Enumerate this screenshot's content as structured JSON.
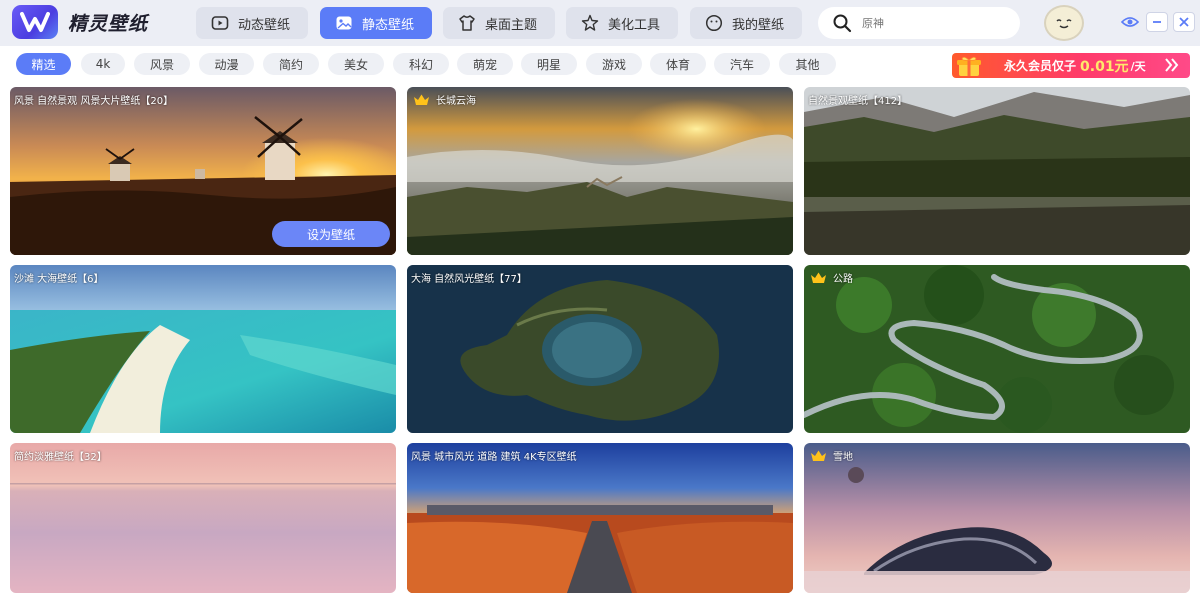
{
  "app": {
    "title": "精灵壁纸"
  },
  "nav": {
    "tabs": [
      {
        "label": "动态壁纸",
        "icon": "play-icon"
      },
      {
        "label": "静态壁纸",
        "icon": "image-icon"
      },
      {
        "label": "桌面主题",
        "icon": "shirt-icon"
      },
      {
        "label": "美化工具",
        "icon": "star-icon"
      },
      {
        "label": "我的壁纸",
        "icon": "smile-icon"
      }
    ],
    "active": "静态壁纸"
  },
  "search": {
    "placeholder": "原神"
  },
  "categories": [
    "精选",
    "4k",
    "风景",
    "动漫",
    "简约",
    "美女",
    "科幻",
    "萌宠",
    "明星",
    "游戏",
    "体育",
    "汽车",
    "其他"
  ],
  "promo": {
    "text": "永久会员仅子",
    "price": "0.01元",
    "unit": "/天"
  },
  "wallpapers": [
    {
      "label": "风景 自然景观 风景大片壁纸【20】",
      "premium": false,
      "action": "设为壁纸"
    },
    {
      "label": "长城云海",
      "premium": true
    },
    {
      "label": "自然景观壁纸【412】",
      "premium": false
    },
    {
      "label": "沙滩 大海壁纸【6】",
      "premium": false
    },
    {
      "label": "大海 自然风光壁纸【77】",
      "premium": false
    },
    {
      "label": "公路",
      "premium": true
    },
    {
      "label": "简约淡雅壁纸【32】",
      "premium": false
    },
    {
      "label": "风景 城市风光 道路 建筑 4K专区壁纸",
      "premium": false
    },
    {
      "label": "雪地",
      "premium": true
    }
  ],
  "colors": {
    "accent": "#5b7cf7",
    "promo": "#ff3b6b"
  }
}
